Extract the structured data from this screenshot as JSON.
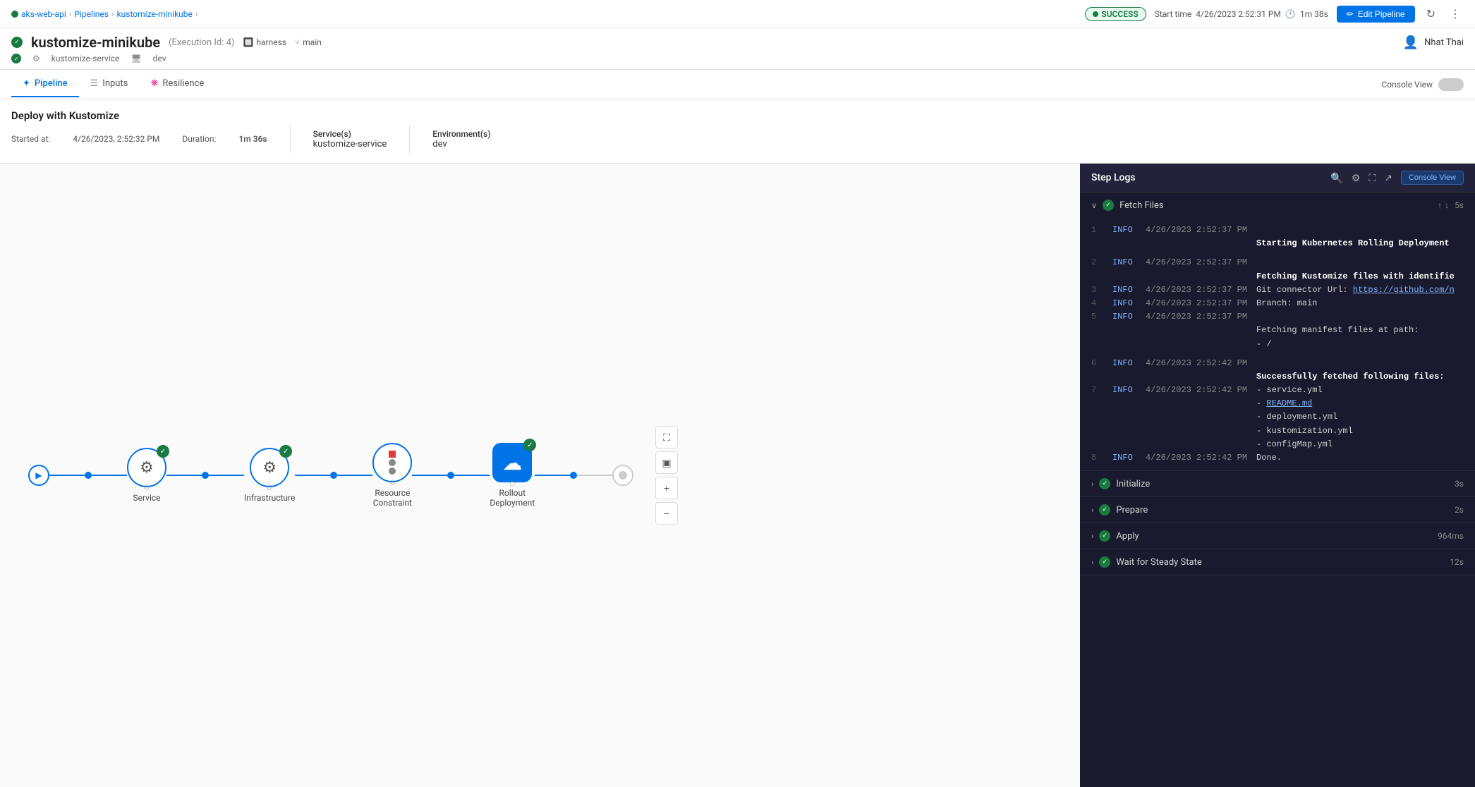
{
  "breadcrumb": {
    "items": [
      "aks-web-api",
      "Pipelines",
      "kustomize-minikube"
    ]
  },
  "status": {
    "label": "SUCCESS",
    "start_time_label": "Start time",
    "start_time": "4/26/2023 2:52:31 PM",
    "duration": "1m 38s"
  },
  "edit_button": "Edit Pipeline",
  "page": {
    "title": "kustomize-minikube",
    "exec_id": "(Execution Id: 4)",
    "harness": "harness",
    "branch": "main",
    "meta_service": "kustomize-service",
    "meta_env": "dev"
  },
  "tabs": {
    "pipeline": "Pipeline",
    "inputs": "Inputs",
    "resilience": "Resilience",
    "console_view": "Console View"
  },
  "deploy": {
    "title": "Deploy with Kustomize",
    "started_label": "Started at:",
    "started_value": "4/26/2023, 2:52:32 PM",
    "duration_label": "Duration:",
    "duration_value": "1m 36s",
    "services_label": "Service(s)",
    "services_value": "kustomize-service",
    "env_label": "Environment(s)",
    "env_value": "dev"
  },
  "pipeline_nodes": [
    {
      "id": "service",
      "label": "Service",
      "type": "gear",
      "checked": true
    },
    {
      "id": "infrastructure",
      "label": "Infrastructure",
      "type": "gear",
      "checked": true
    },
    {
      "id": "resource-constraint",
      "label": "Resource Constraint",
      "type": "resource",
      "checked": false
    },
    {
      "id": "rollout-deployment",
      "label": "Rollout Deployment",
      "type": "rollout",
      "checked": true
    }
  ],
  "logs_panel": {
    "title": "Step Logs",
    "console_view_btn": "Console View",
    "sections": [
      {
        "name": "Fetch Files",
        "status": "success",
        "duration": "5s",
        "expanded": true
      },
      {
        "name": "Initialize",
        "status": "success",
        "duration": "3s",
        "expanded": false
      },
      {
        "name": "Prepare",
        "status": "success",
        "duration": "2s",
        "expanded": false
      },
      {
        "name": "Apply",
        "status": "success",
        "duration": "964ms",
        "expanded": false
      },
      {
        "name": "Wait for Steady State",
        "status": "success",
        "duration": "12s",
        "expanded": false
      }
    ],
    "log_lines": [
      {
        "num": "1",
        "level": "INFO",
        "time": "4/26/2023 2:52:37 PM",
        "msg": "",
        "bold": false
      },
      {
        "num": "",
        "level": "",
        "time": "",
        "msg": "Starting Kubernetes Rolling Deployment",
        "bold": true
      },
      {
        "num": "2",
        "level": "INFO",
        "time": "4/26/2023 2:52:37 PM",
        "msg": "",
        "bold": false
      },
      {
        "num": "",
        "level": "",
        "time": "",
        "msg": "Fetching Kustomize files with identifie",
        "bold": true
      },
      {
        "num": "3",
        "level": "INFO",
        "time": "4/26/2023 2:52:37 PM",
        "msg": "Git connector Url: https://github.com/n",
        "bold": false
      },
      {
        "num": "4",
        "level": "INFO",
        "time": "4/26/2023 2:52:37 PM",
        "msg": "Branch: main",
        "bold": false
      },
      {
        "num": "5",
        "level": "INFO",
        "time": "4/26/2023 2:52:37 PM",
        "msg": "",
        "bold": false
      },
      {
        "num": "",
        "level": "",
        "time": "",
        "msg": "Fetching manifest files at path:",
        "bold": false
      },
      {
        "num": "",
        "level": "",
        "time": "",
        "msg": "- /",
        "bold": false
      },
      {
        "num": "6",
        "level": "INFO",
        "time": "4/26/2023 2:52:42 PM",
        "msg": "",
        "bold": false
      },
      {
        "num": "",
        "level": "",
        "time": "",
        "msg": "Successfully fetched following files:",
        "bold": true
      },
      {
        "num": "7",
        "level": "INFO",
        "time": "4/26/2023 2:52:42 PM",
        "msg": "- service.yml",
        "bold": false
      },
      {
        "num": "",
        "level": "",
        "time": "",
        "msg": "- README.md",
        "bold": false,
        "link": true
      },
      {
        "num": "",
        "level": "",
        "time": "",
        "msg": "- deployment.yml",
        "bold": false
      },
      {
        "num": "",
        "level": "",
        "time": "",
        "msg": "- kustomization.yml",
        "bold": false
      },
      {
        "num": "",
        "level": "",
        "time": "",
        "msg": "- configMap.yml",
        "bold": false
      },
      {
        "num": "8",
        "level": "INFO",
        "time": "4/26/2023 2:52:42 PM",
        "msg": "Done.",
        "bold": false
      }
    ]
  },
  "icons": {
    "pencil": "✏",
    "refresh": "↻",
    "more": "⋮",
    "check": "✓",
    "play": "▶",
    "search": "🔍",
    "gear": "⚙",
    "expand": "⛶",
    "external": "↗",
    "up_arrow": "↑",
    "down_arrow": "↓",
    "chevron_right": "›",
    "chevron_down": "∨",
    "plus": "+",
    "minus": "−",
    "fullscreen": "⛶"
  }
}
